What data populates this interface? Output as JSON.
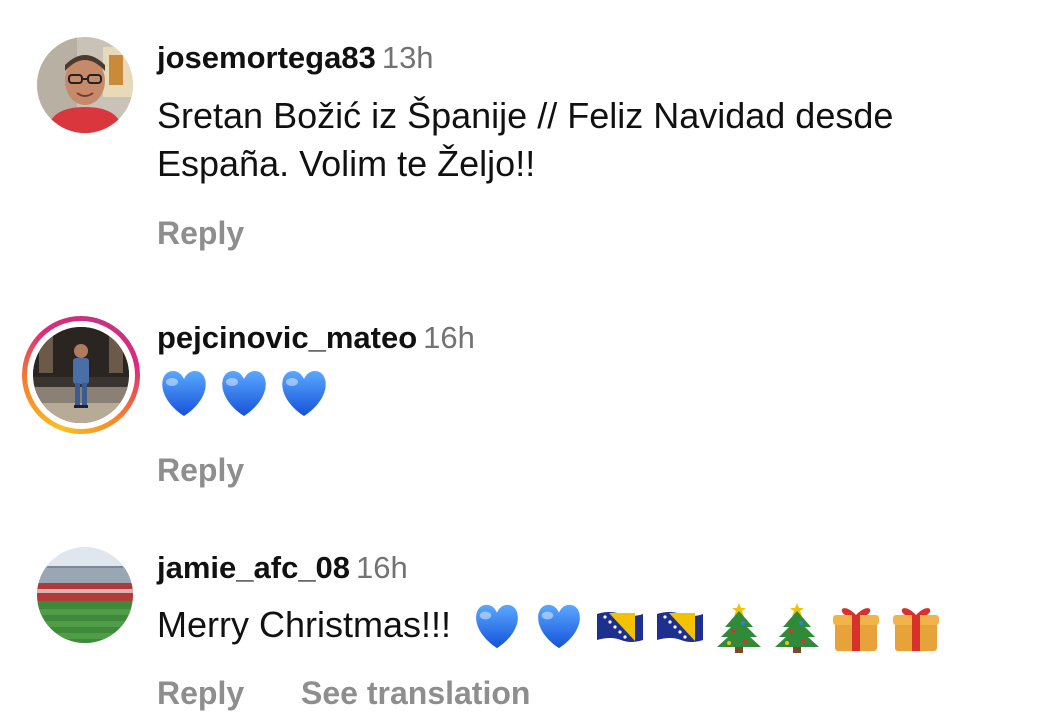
{
  "comments": [
    {
      "username": "josemortega83",
      "time": "13h",
      "text_line1": "Sretan Božić iz Španije // Feliz Navidad desde",
      "text_line2": "España. Volim te Željo!!",
      "reply_label": "Reply",
      "avatar": "profile-photo-man-glasses"
    },
    {
      "username": "pejcinovic_mateo",
      "time": "16h",
      "emojis": [
        "blue-heart",
        "blue-heart",
        "blue-heart"
      ],
      "reply_label": "Reply",
      "avatar": "profile-photo-man-suit",
      "has_story_ring": true
    },
    {
      "username": "jamie_afc_08",
      "time": "16h",
      "text": "Merry Christmas!!!",
      "emojis": [
        "blue-heart",
        "blue-heart",
        "bosnia-flag",
        "bosnia-flag",
        "christmas-tree",
        "christmas-tree",
        "wrapped-gift",
        "wrapped-gift"
      ],
      "reply_label": "Reply",
      "see_translation_label": "See translation",
      "avatar": "profile-photo-stadium"
    }
  ],
  "colors": {
    "text": "#111111",
    "meta": "#737373",
    "action": "#8e8e8e",
    "heart_blue": "#1a6ff0",
    "story_ring": [
      "#f9c022",
      "#f58529",
      "#dd2a7b",
      "#c13584"
    ]
  }
}
